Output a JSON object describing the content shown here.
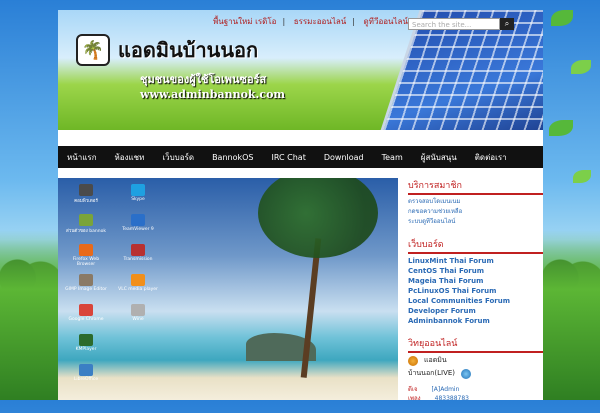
{
  "header": {
    "top_links": [
      "พื้นฐานใหม่ เรดิโอ",
      "ธรรมะออนไลน์",
      "ดูทีวีออนไลน์"
    ],
    "search_placeholder": "Search the site...",
    "site_title": "แอดมินบ้านนอก",
    "subtitle": "ชุมชนของผู้ใช้โอเพนซอร์ส",
    "url": "www.adminbannok.com"
  },
  "nav": {
    "items": [
      "หน้าแรก",
      "ห้องแชท",
      "เว็บบอร์ด",
      "BannokOS",
      "IRC Chat",
      "Download",
      "Team",
      "ผู้สนับสนุน",
      "ติดต่อเรา"
    ]
  },
  "desktop": {
    "icons": [
      {
        "label": "คอมพิวเตอร์",
        "color": "#4b4b4b"
      },
      {
        "label": "ส่วนตัวของ bannok",
        "color": "#7aa43a"
      },
      {
        "label": "Firefox Web Browser",
        "color": "#e86a1a"
      },
      {
        "label": "GIMP Image Editor",
        "color": "#8a7a66"
      },
      {
        "label": "Google Chrome",
        "color": "#d9453a"
      },
      {
        "label": "KMPlayer",
        "color": "#2c6b2c"
      },
      {
        "label": "LibreOffice",
        "color": "#3b7fc4"
      },
      {
        "label": "Skype",
        "color": "#1ea0e1"
      },
      {
        "label": "TeamViewer 9",
        "color": "#2a6fc9"
      },
      {
        "label": "Transmission",
        "color": "#b83030"
      },
      {
        "label": "VLC media player",
        "color": "#f18f1a"
      },
      {
        "label": "Wine",
        "color": "#b0b0b0"
      }
    ]
  },
  "sidebar": {
    "members": {
      "title": "บริการสมาชิก",
      "links": [
        "ตรวจสอบโดเมนเนม",
        "กดขอความช่วยเหลือ",
        "ระบบดูทีวีออนไลน์"
      ]
    },
    "webboard": {
      "title": "เว็บบอร์ด",
      "links": [
        "LinuxMint Thai Forum",
        "CentOS Thai Forum",
        "Mageia Thai Forum",
        "PcLinuxOS Thai Forum",
        "Local Communities Forum",
        "Developer Forum",
        "Adminbannok Forum"
      ]
    },
    "radio": {
      "title": "วิทยุออนไลน์",
      "line1": "แอดมิน",
      "line2": "บ้านนอก(LIVE)",
      "rows": [
        {
          "k": "ดีเจ",
          "v": "[A]Admin"
        },
        {
          "k": "เพลง",
          "v": "483388783"
        }
      ]
    }
  },
  "colors": {
    "accent_red": "#c02020",
    "link_blue": "#2a6ab5",
    "nav_bg": "#111111"
  }
}
